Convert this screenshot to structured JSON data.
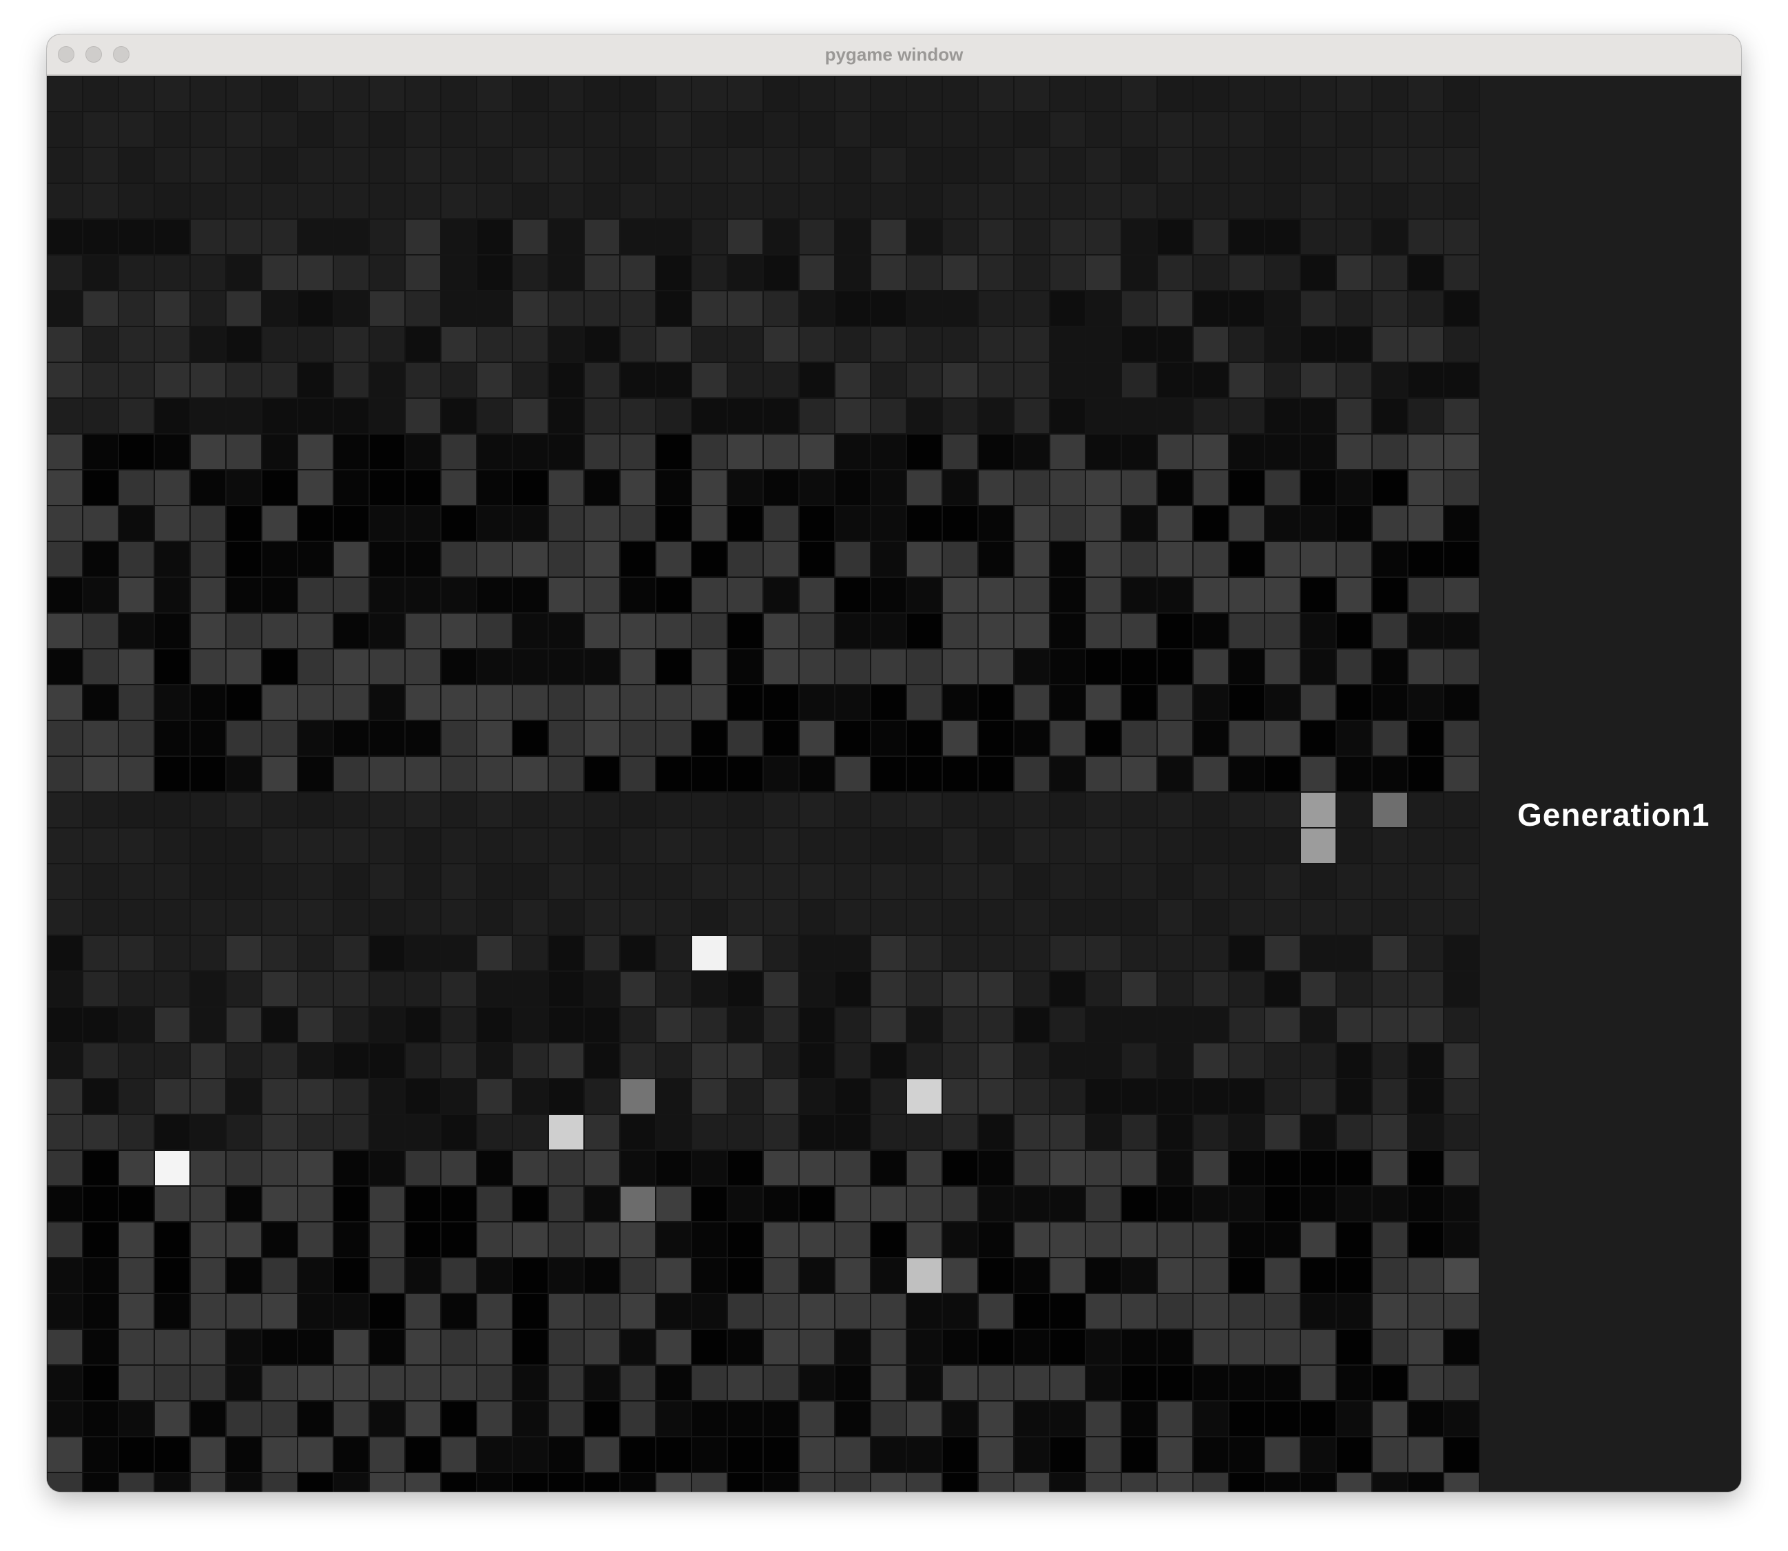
{
  "window": {
    "title": "pygame window"
  },
  "hud": {
    "generation_label": "Generation1"
  },
  "colors": {
    "frame": "#e6e4e2",
    "title_text": "#9a9896",
    "panel": "#1d1d1d",
    "grid_line": "#151515",
    "gen_text": "#ffffff"
  }
}
